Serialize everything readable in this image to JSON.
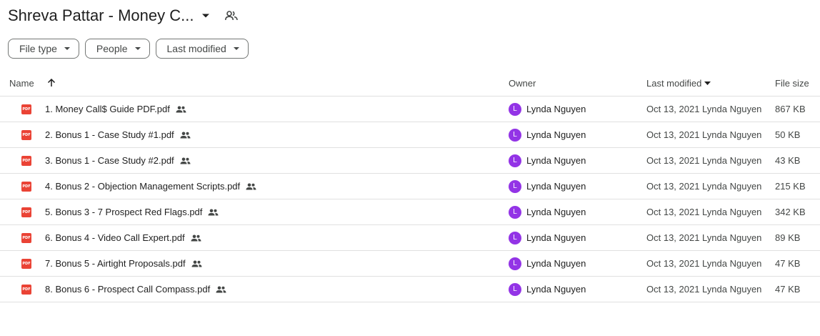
{
  "header": {
    "folder_title": "Shreva Pattar - Money C..."
  },
  "filters": [
    {
      "label": "File type"
    },
    {
      "label": "People"
    },
    {
      "label": "Last modified"
    }
  ],
  "table": {
    "columns": {
      "name": "Name",
      "owner": "Owner",
      "last_modified": "Last modified",
      "file_size": "File size"
    },
    "rows": [
      {
        "name": "1. Money Call$ Guide PDF.pdf",
        "owner_initial": "L",
        "owner": "Lynda Nguyen",
        "modified": "Oct 13, 2021 Lynda Nguyen",
        "size": "867 KB"
      },
      {
        "name": "2. Bonus 1 - Case Study #1.pdf",
        "owner_initial": "L",
        "owner": "Lynda Nguyen",
        "modified": "Oct 13, 2021 Lynda Nguyen",
        "size": "50 KB"
      },
      {
        "name": "3. Bonus 1 - Case Study #2.pdf",
        "owner_initial": "L",
        "owner": "Lynda Nguyen",
        "modified": "Oct 13, 2021 Lynda Nguyen",
        "size": "43 KB"
      },
      {
        "name": "4. Bonus 2 - Objection Management Scripts.pdf",
        "owner_initial": "L",
        "owner": "Lynda Nguyen",
        "modified": "Oct 13, 2021 Lynda Nguyen",
        "size": "215 KB"
      },
      {
        "name": "5. Bonus 3 - 7 Prospect Red Flags.pdf",
        "owner_initial": "L",
        "owner": "Lynda Nguyen",
        "modified": "Oct 13, 2021 Lynda Nguyen",
        "size": "342 KB"
      },
      {
        "name": "6. Bonus 4 - Video Call Expert.pdf",
        "owner_initial": "L",
        "owner": "Lynda Nguyen",
        "modified": "Oct 13, 2021 Lynda Nguyen",
        "size": "89 KB"
      },
      {
        "name": "7. Bonus 5 - Airtight Proposals.pdf",
        "owner_initial": "L",
        "owner": "Lynda Nguyen",
        "modified": "Oct 13, 2021 Lynda Nguyen",
        "size": "47 KB"
      },
      {
        "name": "8. Bonus 6 - Prospect Call Compass.pdf",
        "owner_initial": "L",
        "owner": "Lynda Nguyen",
        "modified": "Oct 13, 2021 Lynda Nguyen",
        "size": "47 KB"
      }
    ]
  },
  "icons": {
    "file": "pdf-icon",
    "shared": "shared-people-icon",
    "sort": "arrow-up-icon",
    "dropdown": "caret-down-icon"
  },
  "colors": {
    "pdf_red": "#ea4335",
    "avatar_purple": "#9334e6"
  },
  "pdf_badge": "PDF"
}
